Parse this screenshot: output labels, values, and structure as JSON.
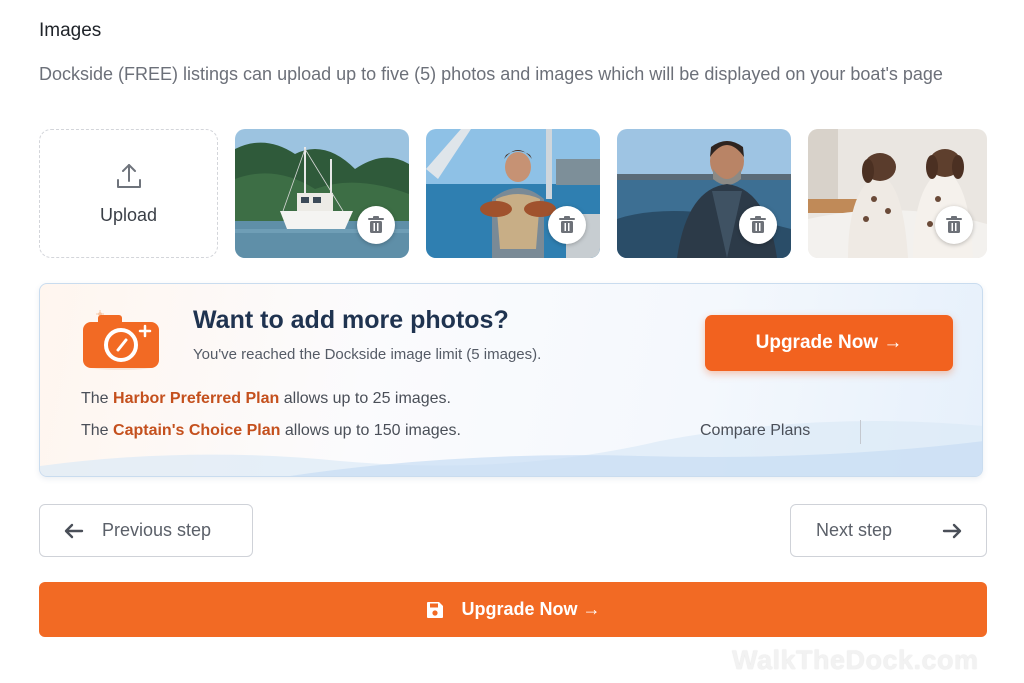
{
  "section": {
    "title": "Images",
    "description": "Dockside (FREE) listings can upload up to five (5) photos and images which will be displayed on your boat's page"
  },
  "upload": {
    "label": "Upload",
    "icon": "upload-icon"
  },
  "photos": [
    {
      "icon": "trash-icon"
    },
    {
      "icon": "trash-icon"
    },
    {
      "icon": "trash-icon"
    },
    {
      "icon": "trash-icon"
    }
  ],
  "promo": {
    "title": "Want to add more photos?",
    "subtitle": "You've reached the Dockside image limit (5 images).",
    "line1_prefix": "The ",
    "line1_plan": "Harbor Preferred Plan",
    "line1_suffix": " allows up to 25 images.",
    "line2_prefix": "The ",
    "line2_plan": "Captain's Choice Plan",
    "line2_suffix": " allows up to 150 images.",
    "upgrade_label": "Upgrade Now →",
    "compare_label": "Compare Plans"
  },
  "nav": {
    "prev_label": "Previous step",
    "next_label": "Next step"
  },
  "footer": {
    "upgrade_label": "Upgrade Now →",
    "watermark": "WalkTheDock.com"
  },
  "colors": {
    "accent": "#f2621f",
    "plan_highlight": "#c4501d",
    "title_navy": "#1f3350"
  }
}
